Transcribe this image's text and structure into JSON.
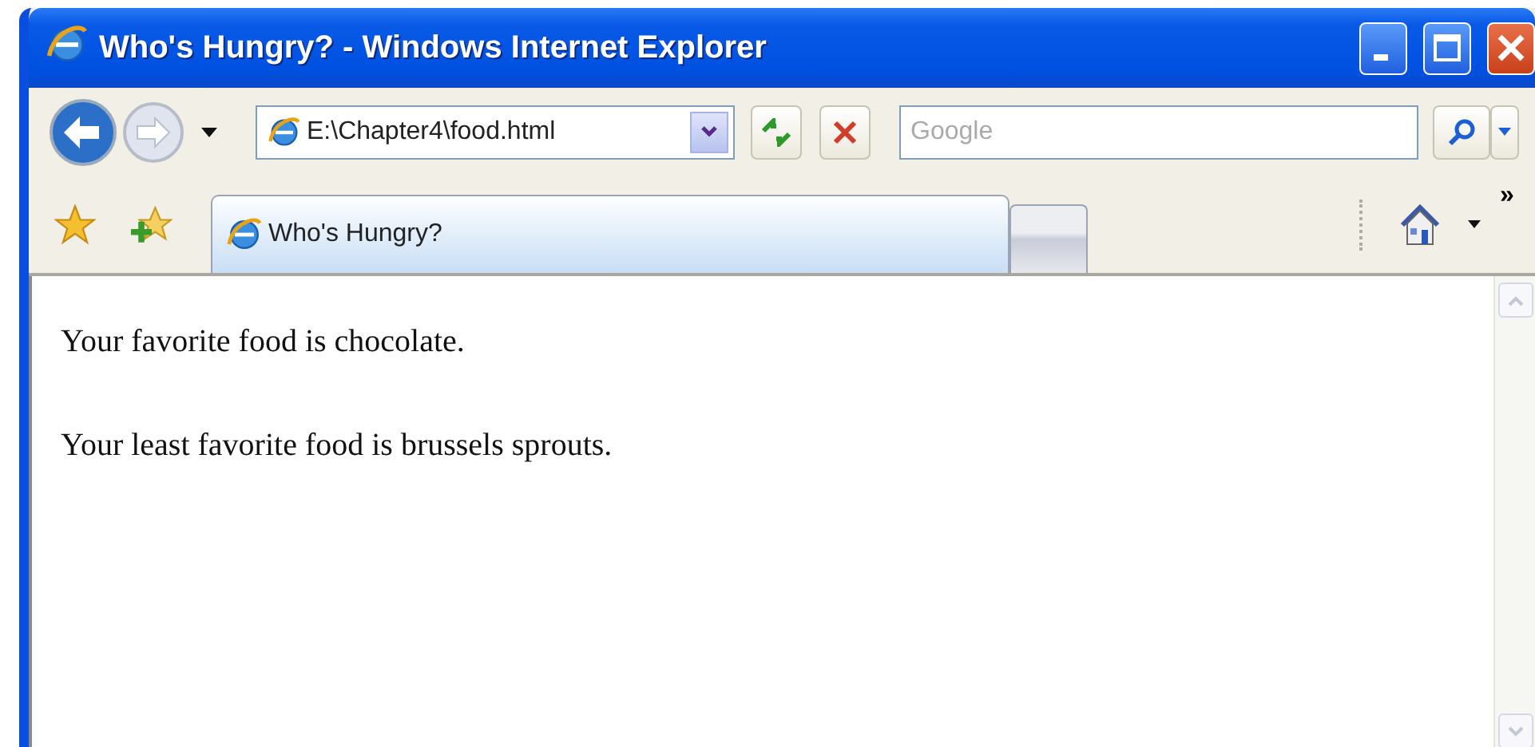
{
  "window": {
    "title": "Who's Hungry? - Windows Internet Explorer"
  },
  "address_bar": {
    "value": "E:\\Chapter4\\food.html"
  },
  "search": {
    "placeholder": "Google"
  },
  "tabs": [
    {
      "label": "Who's Hungry?",
      "selected": true
    }
  ],
  "command_bar": {
    "overflow": "»"
  },
  "page": {
    "paragraphs": [
      "Your favorite food is chocolate.",
      "Your least favorite food is brussels sprouts."
    ]
  }
}
